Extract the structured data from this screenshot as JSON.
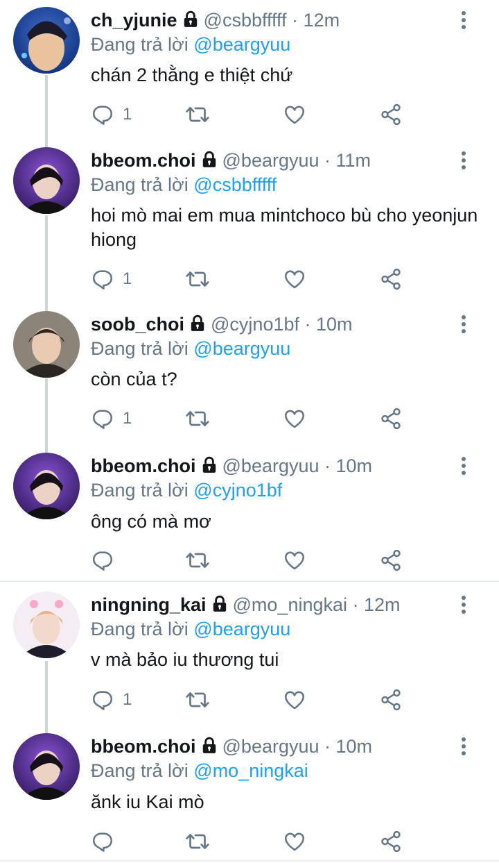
{
  "reply_prefix": "Đang trả lời",
  "colors": {
    "accent": "#1da1f2",
    "secondary": "#657786",
    "line": "#ccd6dd"
  },
  "tweets": [
    {
      "display_name": "ch_yjunie",
      "handle": "@csbbfffff",
      "time": "12m",
      "reply_to": "@beargyuu",
      "text": "chán 2 thằng e thiệt chứ",
      "reply_count": "1"
    },
    {
      "display_name": "bbeom.choi",
      "handle": "@beargyuu",
      "time": "11m",
      "reply_to": "@csbbfffff",
      "text": "hoi mò mai em mua mintchoco bù cho yeonjun hiong",
      "reply_count": "1"
    },
    {
      "display_name": "soob_choi",
      "handle": "@cyjno1bf",
      "time": "10m",
      "reply_to": "@beargyuu",
      "text": "còn của t?",
      "reply_count": "1"
    },
    {
      "display_name": "bbeom.choi",
      "handle": "@beargyuu",
      "time": "10m",
      "reply_to": "@cyjno1bf",
      "text": "ông có mà mơ",
      "reply_count": ""
    },
    {
      "display_name": "ningning_kai",
      "handle": "@mo_ningkai",
      "time": "12m",
      "reply_to": "@beargyuu",
      "text": "v mà bảo iu thương tui",
      "reply_count": "1"
    },
    {
      "display_name": "bbeom.choi",
      "handle": "@beargyuu",
      "time": "10m",
      "reply_to": "@mo_ningkai",
      "text": "ănk iu Kai mò",
      "reply_count": ""
    }
  ]
}
